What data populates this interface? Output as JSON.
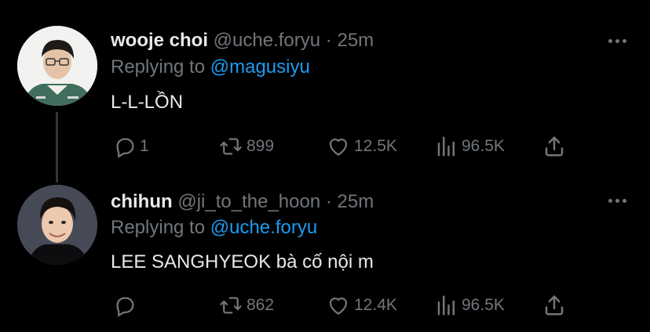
{
  "tweets": [
    {
      "name": "wooje choi",
      "handle": "@uche.foryu",
      "separator": "·",
      "time": "25m",
      "replying_prefix": "Replying to",
      "replying_handle": "@magusiyu",
      "text": "L-L-LỒN",
      "replies": "1",
      "retweets": "899",
      "likes": "12.5K",
      "views": "96.5K"
    },
    {
      "name": "chihun",
      "handle": "@ji_to_the_hoon",
      "separator": "·",
      "time": "25m",
      "replying_prefix": "Replying to",
      "replying_handle": "@uche.foryu",
      "text": "LEE SANGHYEOK bà cố nội m",
      "replies": "",
      "retweets": "862",
      "likes": "12.4K",
      "views": "96.5K"
    }
  ],
  "icons": {
    "reply": "reply-icon",
    "retweet": "retweet-icon",
    "like": "heart-icon",
    "views": "views-icon",
    "share": "share-icon",
    "more": "more-icon"
  },
  "colors": {
    "background": "#000000",
    "text": "#e7e9ea",
    "muted": "#71767b",
    "link": "#1d9bf0",
    "thread_line": "#333639"
  }
}
